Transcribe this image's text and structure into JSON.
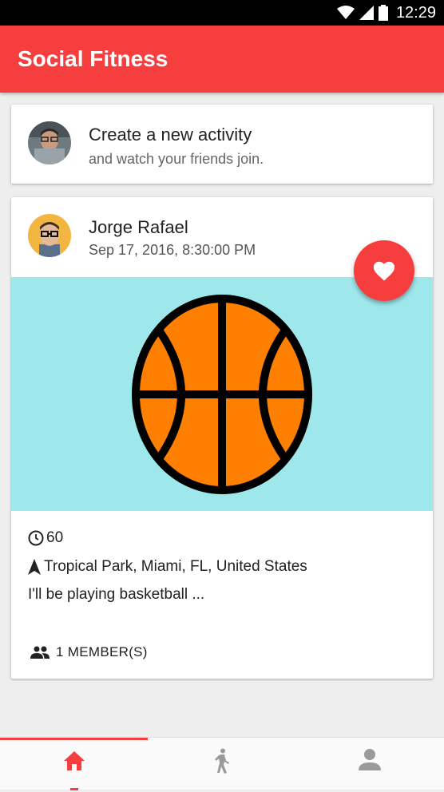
{
  "status": {
    "time": "12:29"
  },
  "app": {
    "title": "Social Fitness"
  },
  "create": {
    "title": "Create a new activity",
    "subtitle": "and watch your friends join."
  },
  "activity": {
    "user": "Jorge Rafael",
    "date": "Sep 17, 2016, 8:30:00 PM",
    "duration": "60",
    "location": "Tropical Park, Miami, FL, United States",
    "description": "I'll be playing basketball ...",
    "members": "1 MEMBER(S)"
  },
  "nav": {
    "items": [
      {
        "name": "home",
        "icon": "home-icon",
        "active": true
      },
      {
        "name": "activities",
        "icon": "walking-icon",
        "active": false
      },
      {
        "name": "profile",
        "icon": "person-icon",
        "active": false
      }
    ]
  },
  "colors": {
    "primary": "#f63e3f",
    "image_bg": "#9ee8eb",
    "ball": "#ff8000"
  }
}
